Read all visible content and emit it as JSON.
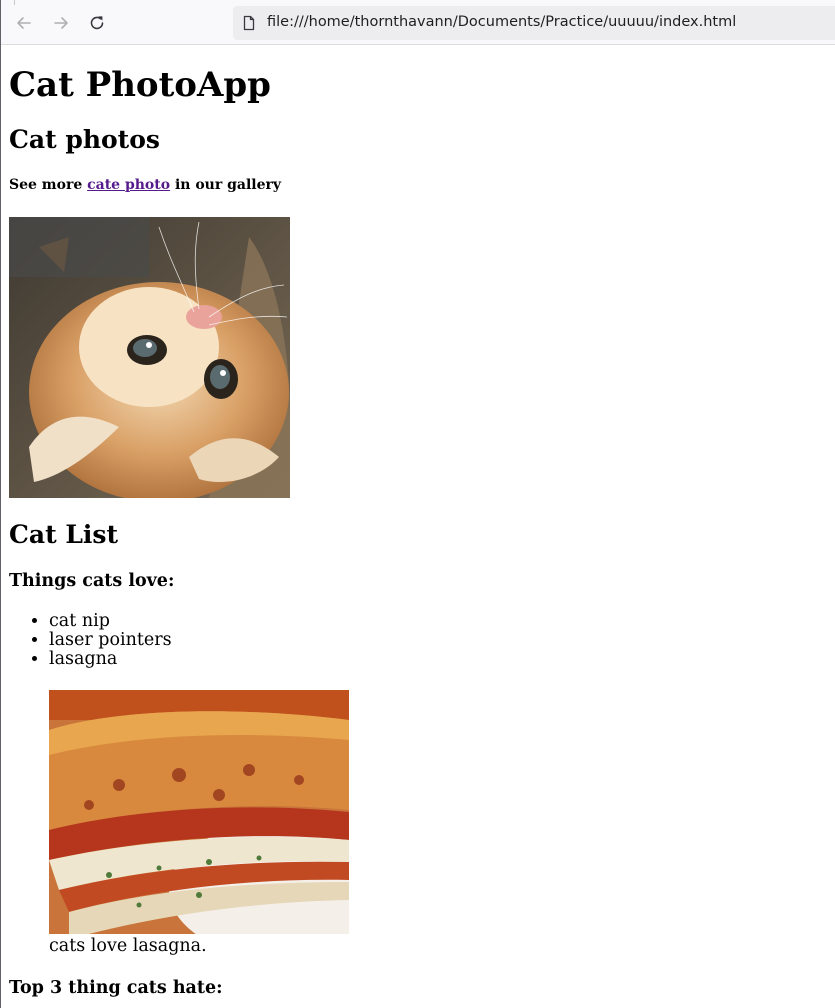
{
  "browser": {
    "back_icon": "arrow-left-icon",
    "forward_icon": "arrow-right-icon",
    "reload_icon": "reload-icon",
    "page_icon": "document-icon",
    "url": "file:///home/thornthavann/Documents/Practice/uuuuu/index.html"
  },
  "page": {
    "title": "Cat PhotoApp",
    "photos_heading": "Cat photos",
    "gallery_text_before": "See more ",
    "gallery_link": "cate photo",
    "gallery_text_after": " in our gallery",
    "cat_image_label": "kitten lying on its back",
    "list_heading": "Cat List",
    "love_heading": "Things cats love:",
    "love_items": [
      "cat nip",
      "laser pointers",
      "lasagna"
    ],
    "lasagna_image_label": "slice of lasagna",
    "lasagna_caption": "cats love lasagna.",
    "hate_heading": "Top 3 thing cats hate:"
  },
  "colors": {
    "link_visited": "#551a8b",
    "toolbar_bg": "#f9f9fb",
    "urlbar_bg": "#ededf0"
  }
}
